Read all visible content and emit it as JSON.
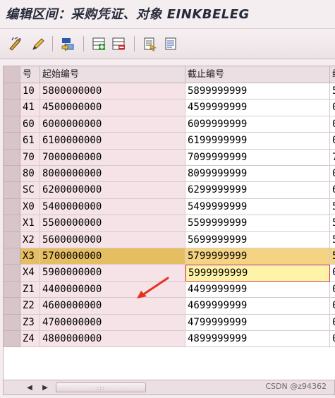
{
  "window": {
    "title": "编辑区间：采购凭证、对象 EINKBELEG"
  },
  "toolbar": {
    "icons": [
      "change-mode-icon",
      "edit-icon",
      "select-icon",
      "insert-row-icon",
      "delete-row-icon",
      "detail-icon",
      "overview-icon"
    ]
  },
  "table": {
    "columns": [
      "号",
      "起始编号",
      "截止编号",
      "编"
    ],
    "rows": [
      {
        "no": "10",
        "from": "5800000000",
        "to": "5899999999",
        "extra": "5"
      },
      {
        "no": "41",
        "from": "4500000000",
        "to": "4599999999",
        "extra": "0"
      },
      {
        "no": "60",
        "from": "6000000000",
        "to": "6099999999",
        "extra": "0"
      },
      {
        "no": "61",
        "from": "6100000000",
        "to": "6199999999",
        "extra": "0"
      },
      {
        "no": "70",
        "from": "7000000000",
        "to": "7099999999",
        "extra": "7"
      },
      {
        "no": "80",
        "from": "8000000000",
        "to": "8099999999",
        "extra": "0"
      },
      {
        "no": "SC",
        "from": "6200000000",
        "to": "6299999999",
        "extra": "6"
      },
      {
        "no": "X0",
        "from": "5400000000",
        "to": "5499999999",
        "extra": "5"
      },
      {
        "no": "X1",
        "from": "5500000000",
        "to": "5599999999",
        "extra": "5"
      },
      {
        "no": "X2",
        "from": "5600000000",
        "to": "5699999999",
        "extra": "5"
      },
      {
        "no": "X3",
        "from": "5700000000",
        "to": "5799999999",
        "extra": "5"
      },
      {
        "no": "X4",
        "from": "5900000000",
        "to": "5999999999",
        "extra": "0"
      },
      {
        "no": "Z1",
        "from": "4400000000",
        "to": "4499999999",
        "extra": "0"
      },
      {
        "no": "Z2",
        "from": "4600000000",
        "to": "4699999999",
        "extra": "0"
      },
      {
        "no": "Z3",
        "from": "4700000000",
        "to": "4799999999",
        "extra": "0"
      },
      {
        "no": "Z4",
        "from": "4800000000",
        "to": "4899999999",
        "extra": "0"
      }
    ],
    "highlighted_row": "X3",
    "focused_row": "X4"
  },
  "scrollbar": {
    "left_arrow": "◀",
    "right_arrow": "▶",
    "thumb_grip": ":::"
  },
  "watermark": "CSDN @z94362",
  "colors": {
    "accent_highlight": "#f4d482",
    "focus_border": "#e03a3a",
    "arrow": "#e8321e"
  }
}
